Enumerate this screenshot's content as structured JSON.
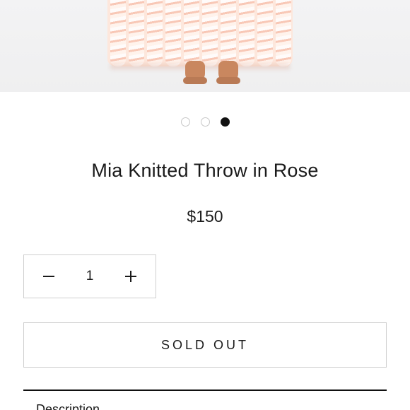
{
  "product": {
    "image_alt": "pink chunky knit throw held up, bare feet below",
    "gallery": {
      "count": 3,
      "active_index": 2
    },
    "title": "Mia Knitted Throw in Rose",
    "price": "$150"
  },
  "quantity": {
    "value": "1",
    "decrease_icon": "minus-icon",
    "increase_icon": "plus-icon"
  },
  "purchase": {
    "button_label": "SOLD OUT"
  },
  "accordion": {
    "description_label": "Description",
    "toggle_icon": "chevron-down-icon"
  },
  "colors": {
    "text": "#1a1a1a",
    "border": "#cfcfcf",
    "active_dot": "#111111",
    "blanket": "#fde7dc"
  }
}
